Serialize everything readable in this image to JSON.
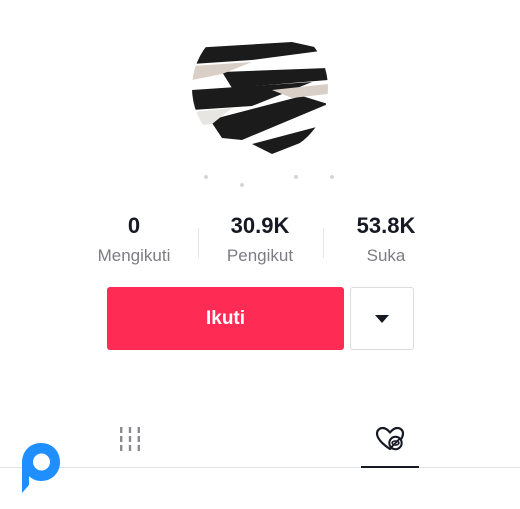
{
  "profile": {
    "stats": [
      {
        "value": "0",
        "label": "Mengikuti"
      },
      {
        "value": "30.9K",
        "label": "Pengikut"
      },
      {
        "value": "53.8K",
        "label": "Suka"
      }
    ]
  },
  "actions": {
    "follow_label": "Ikuti"
  },
  "icons": {
    "more": "caret-down-icon",
    "tab_videos": "grid-icon",
    "tab_liked": "hidden-heart-icon",
    "watermark": "logo-icon"
  },
  "colors": {
    "accent": "#fe2c55",
    "text_primary": "#161823",
    "text_secondary": "#7c7d83",
    "watermark": "#1f8fff"
  }
}
